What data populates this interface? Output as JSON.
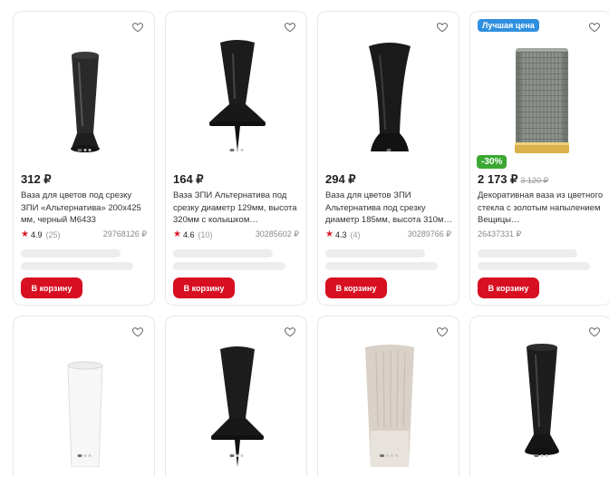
{
  "products": [
    {
      "price": "312 ₽",
      "title": "Ваза для цветов под срезку ЗПИ «Альтернатива» 200х425 мм, черный М6433",
      "rating": "4.9",
      "reviews": "(25)",
      "sku": "29768126",
      "currency_icon": "ruble-icon",
      "cart_label": "В корзину"
    },
    {
      "price": "164 ₽",
      "title": "Ваза ЗПИ Альтернатива под срезку диаметр 129мм, высота 320мм с колышком…",
      "rating": "4.6",
      "reviews": "(10)",
      "sku": "30285602",
      "cart_label": "В корзину"
    },
    {
      "price": "294 ₽",
      "title": "Ваза для цветов ЗПИ Альтернатива под срезку диаметр 185мм, высота 310м…",
      "rating": "4.3",
      "reviews": "(4)",
      "sku": "30289766",
      "cart_label": "В корзину"
    },
    {
      "badge": "Лучшая цена",
      "discount": "-30%",
      "price": "2 173 ₽",
      "old_price": "3 120 ₽",
      "title": "Декоративная ваза из цветного стекла с золотым напылением Вещицы…",
      "sku": "26437331",
      "cart_label": "В корзину"
    }
  ],
  "colors": {
    "accent_red": "#d70f20",
    "badge_blue": "#2f8fdf",
    "discount_green": "#3aa832"
  }
}
